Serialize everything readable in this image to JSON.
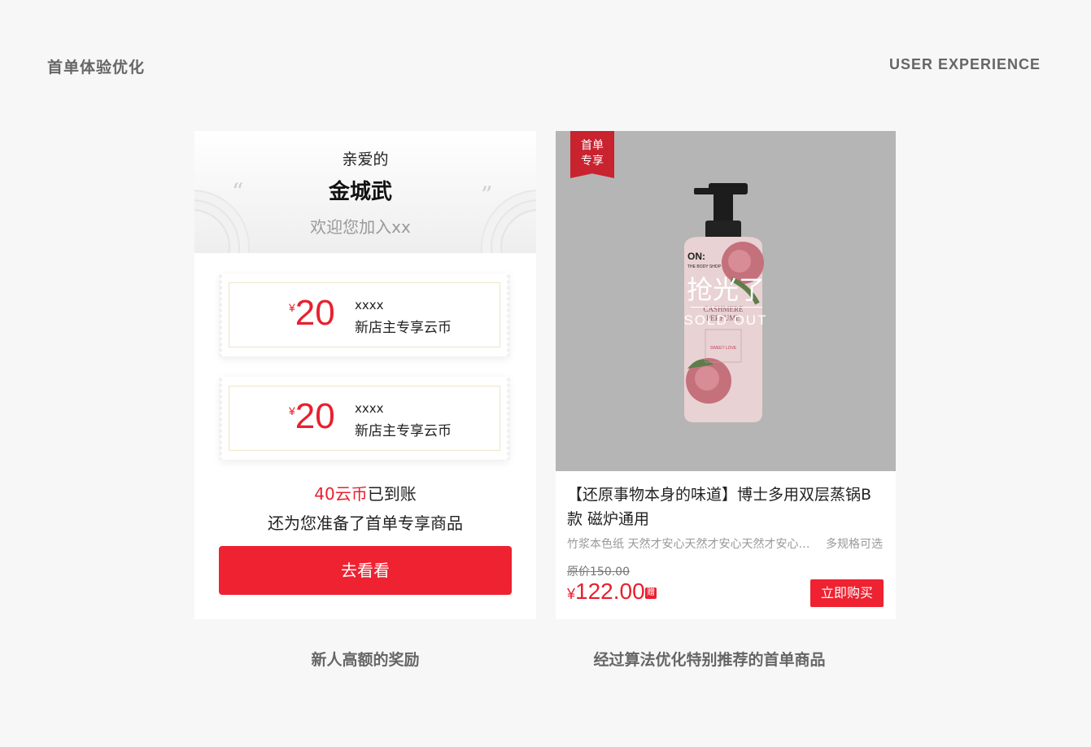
{
  "header": {
    "title_cn": "首单体验优化",
    "title_en": "USER EXPERIENCE"
  },
  "welcome_card": {
    "greeting": "亲爱的",
    "name": "金城武",
    "welcome_text": "欢迎您加入xx",
    "coupons": [
      {
        "currency": "¥",
        "amount": "20",
        "line1": "xxxx",
        "line2": "新店主专享云币"
      },
      {
        "currency": "¥",
        "amount": "20",
        "line1": "xxxx",
        "line2": "新店主专享云币"
      }
    ],
    "arrived_amount": "40云币",
    "arrived_text": "已到账",
    "prepared_text": "还为您准备了首单专享商品",
    "cta_label": "去看看"
  },
  "product_card": {
    "ribbon": "首单\n专享",
    "ribbon_line1": "首单",
    "ribbon_line2": "专享",
    "sold_out_cn": "抢光了",
    "sold_out_en": "SOLD OUT",
    "title": "【还原事物本身的味道】博士多用双层蒸锅B款 磁炉通用",
    "description": "竹浆本色纸 天然才安心天然才安心天然才安心天然才安心",
    "spec": "多规格可选",
    "original_price": "原价150.00",
    "currency": "¥",
    "price": "122.00",
    "gift_badge": "赠",
    "buy_label": "立即购买",
    "bottle_brand": "ON:",
    "bottle_brand_sub": "THE BODY SHOP",
    "bottle_name1": "CASHMERE",
    "bottle_name2": "PERFUME",
    "bottle_sub": "SWEET LOVE"
  },
  "captions": {
    "left": "新人高额的奖励",
    "right": "经过算法优化特别推荐的首单商品"
  },
  "colors": {
    "accent_red": "#e8202e",
    "button_red": "#ee2231",
    "ribbon_red": "#c8232f",
    "background": "#f7f7f7"
  }
}
